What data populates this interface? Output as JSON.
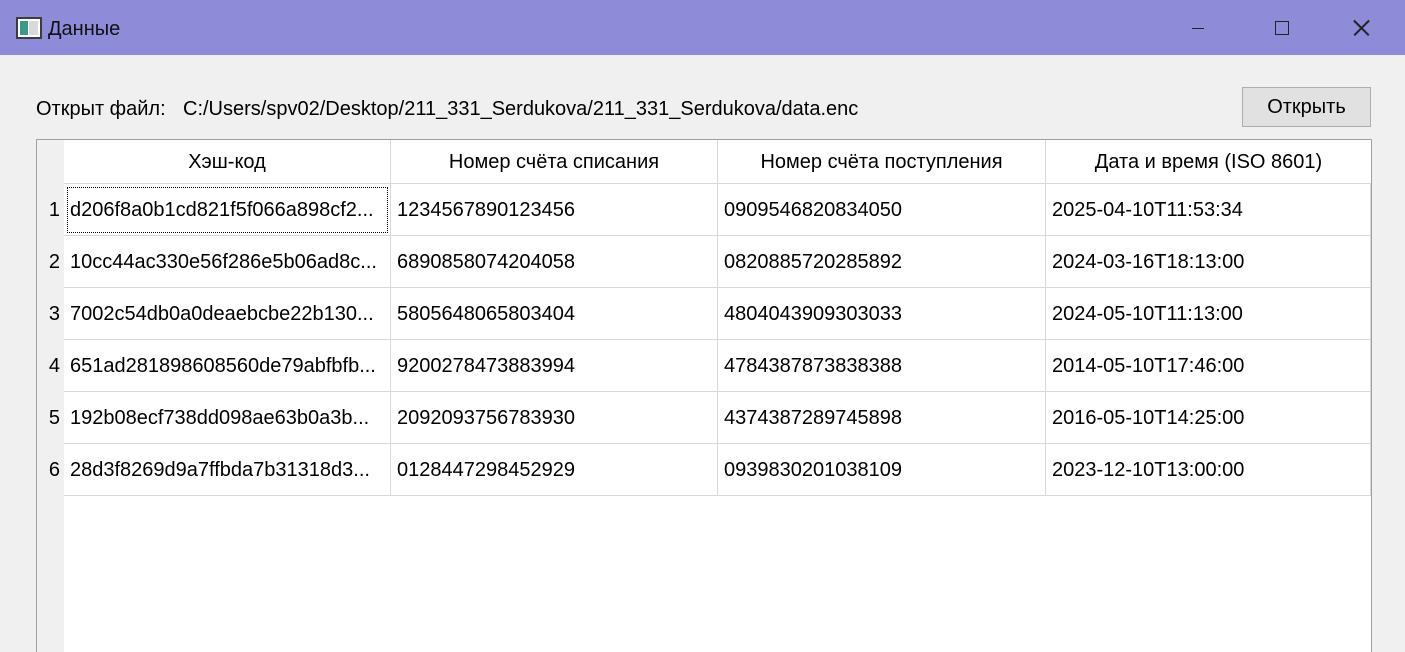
{
  "window": {
    "title": "Данные"
  },
  "file_row": {
    "label": "Открыт файл:",
    "path": "C:/Users/spv02/Desktop/211_331_Serdukova/211_331_Serdukova/data.enc",
    "open_button": "Открыть"
  },
  "table": {
    "headers": [
      "Хэш-код",
      "Номер счёта списания",
      "Номер счёта поступления",
      "Дата и время (ISO 8601)"
    ],
    "rows": [
      {
        "num": "1",
        "hash": "d206f8a0b1cd821f5f066a898cf2...",
        "from": "1234567890123456",
        "to": "0909546820834050",
        "datetime": "2025-04-10T11:53:34"
      },
      {
        "num": "2",
        "hash": "10cc44ac330e56f286e5b06ad8c...",
        "from": "6890858074204058",
        "to": "0820885720285892",
        "datetime": "2024-03-16T18:13:00"
      },
      {
        "num": "3",
        "hash": "7002c54db0a0deaebcbe22b130...",
        "from": "5805648065803404",
        "to": "4804043909303033",
        "datetime": "2024-05-10T11:13:00"
      },
      {
        "num": "4",
        "hash": "651ad281898608560de79abfbfb...",
        "from": "9200278473883994",
        "to": "4784387873838388",
        "datetime": "2014-05-10T17:46:00"
      },
      {
        "num": "5",
        "hash": "192b08ecf738dd098ae63b0a3b...",
        "from": "2092093756783930",
        "to": "4374387289745898",
        "datetime": "2016-05-10T14:25:00"
      },
      {
        "num": "6",
        "hash": "28d3f8269d9a7ffbda7b31318d3...",
        "from": "0128447298452929",
        "to": "0939830201038109",
        "datetime": "2023-12-10T13:00:00"
      }
    ]
  },
  "icons": {
    "app": "app-icon",
    "minimize": "minimize-icon",
    "maximize": "maximize-icon",
    "close": "close-icon"
  },
  "colors": {
    "titlebar": "#8e8bd8",
    "window_bg": "#f0f0f0",
    "table_bg": "#ffffff"
  }
}
